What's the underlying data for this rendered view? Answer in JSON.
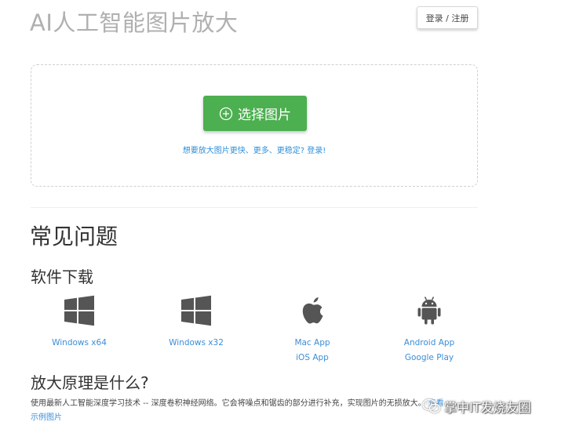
{
  "header": {
    "title": "AI人工智能图片放大",
    "login_label": "登录 / 注册"
  },
  "upload": {
    "button_label": "选择图片",
    "hint": "想要放大图片更快、更多、更稳定? 登录!"
  },
  "faq": {
    "heading": "常见问题"
  },
  "downloads": {
    "heading": "软件下载",
    "windows64": {
      "icon": "windows-icon",
      "label": "Windows x64"
    },
    "windows32": {
      "icon": "windows-icon",
      "label": "Windows x32"
    },
    "apple": {
      "icon": "apple-icon",
      "label1": "Mac App",
      "label2": "iOS App"
    },
    "android": {
      "icon": "android-icon",
      "label1": "Android App",
      "label2": "Google Play"
    }
  },
  "principle": {
    "heading": "放大原理是什么?",
    "text": "使用最新人工智能深度学习技术 -- 深度卷积神经网络。它会将噪点和锯齿的部分进行补充，实现图片的无损放大。",
    "link1": "查看",
    "link2": "示例图片"
  },
  "watermark": {
    "text": "掌中IT发烧友圈"
  },
  "colors": {
    "primary_green": "#4caf50",
    "link_blue": "#3a8ed8",
    "title_gray": "#b0b0b0"
  }
}
